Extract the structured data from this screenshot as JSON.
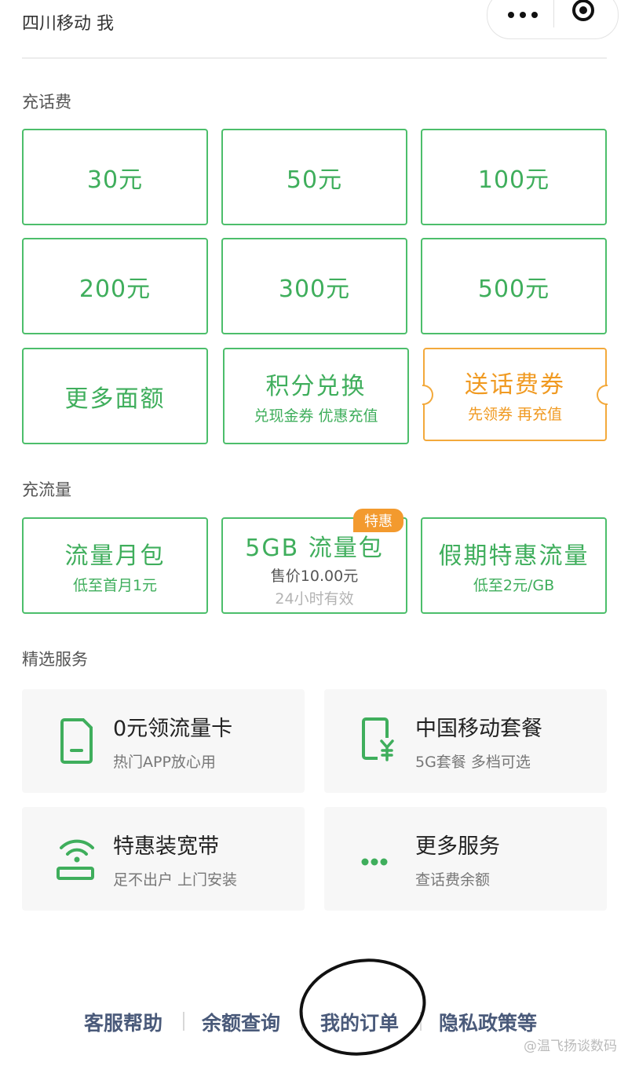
{
  "header": {
    "title": "四川移动 我"
  },
  "sections": {
    "recharge": "充话费",
    "data": "充流量",
    "services": "精选服务"
  },
  "recharge": [
    {
      "label": "30元"
    },
    {
      "label": "50元"
    },
    {
      "label": "100元"
    },
    {
      "label": "200元"
    },
    {
      "label": "300元"
    },
    {
      "label": "500元"
    }
  ],
  "more_amount": {
    "label": "更多面额"
  },
  "points": {
    "title": "积分兑换",
    "sub": "兑现金券 优惠充值"
  },
  "coupon": {
    "title": "送话费券",
    "sub": "先领券 再充值"
  },
  "data_packs": [
    {
      "title": "流量月包",
      "sub": "低至首月1元"
    },
    {
      "title": "5GB 流量包",
      "sub": "售价10.00元",
      "sub2": "24小时有效",
      "badge": "特惠"
    },
    {
      "title": "假期特惠流量",
      "sub": "低至2元/GB"
    }
  ],
  "services": [
    {
      "title": "0元领流量卡",
      "sub": "热门APP放心用",
      "icon": "sim-card-icon"
    },
    {
      "title": "中国移动套餐",
      "sub": "5G套餐 多档可选",
      "icon": "phone-yuan-icon"
    },
    {
      "title": "特惠装宽带",
      "sub": "足不出户 上门安装",
      "icon": "wifi-router-icon"
    },
    {
      "title": "更多服务",
      "sub": "查话费余额",
      "icon": "more-dots-icon"
    }
  ],
  "footer": {
    "links": [
      "客服帮助",
      "余额查询",
      "我的订单",
      "隐私政策等"
    ]
  },
  "watermark": "@温飞扬谈数码",
  "colors": {
    "green": "#4cbe6b",
    "orange": "#f3a93b",
    "footer_text": "#4a5a7a"
  }
}
